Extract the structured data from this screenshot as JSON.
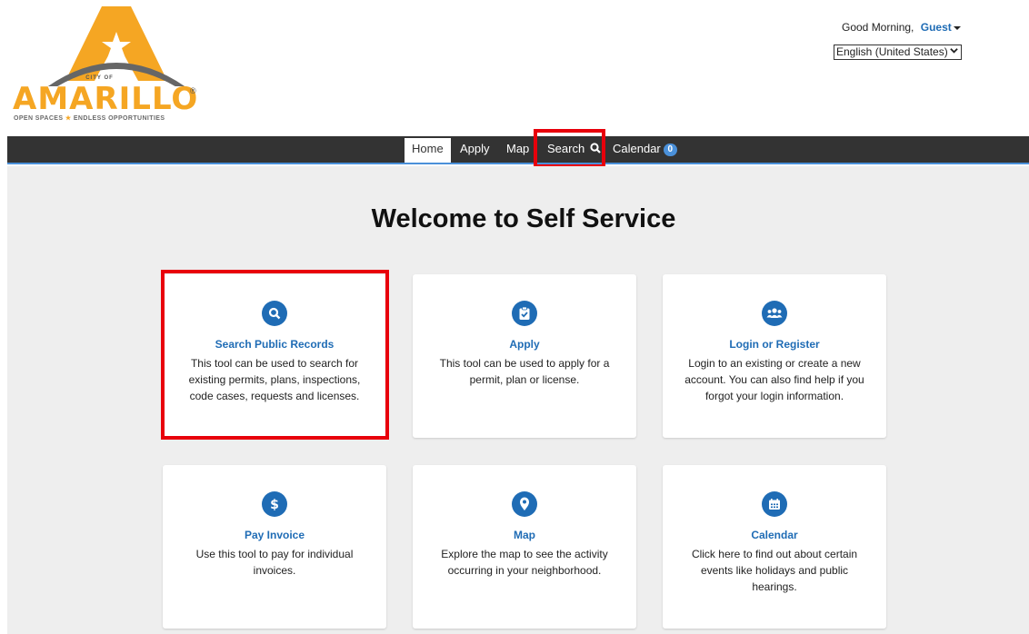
{
  "logo": {
    "city_of": "CITY OF",
    "word": "AMARILLO",
    "registered": "®",
    "tagline_left": "OPEN SPACES",
    "tagline_sep": "★",
    "tagline_right": "ENDLESS OPPORTUNITIES"
  },
  "header": {
    "greeting": "Good Morning,",
    "user": "Guest",
    "language": "English (United States)"
  },
  "nav": {
    "home": "Home",
    "apply": "Apply",
    "map": "Map",
    "search": "Search",
    "calendar": "Calendar",
    "calendar_count": "0"
  },
  "main": {
    "heading": "Welcome to Self Service",
    "cards": [
      {
        "icon": "search-icon",
        "title": "Search Public Records",
        "desc": "This tool can be used to search for existing permits, plans, inspections, code cases, requests and licenses."
      },
      {
        "icon": "clipboard-check-icon",
        "title": "Apply",
        "desc": "This tool can be used to apply for a permit, plan or license."
      },
      {
        "icon": "users-icon",
        "title": "Login or Register",
        "desc": "Login to an existing or create a new account. You can also find help if you forgot your login information."
      },
      {
        "icon": "dollar-icon",
        "title": "Pay Invoice",
        "desc": "Use this tool to pay for individual invoices."
      },
      {
        "icon": "map-pin-icon",
        "title": "Map",
        "desc": "Explore the map to see the activity occurring in your neighborhood."
      },
      {
        "icon": "calendar-icon",
        "title": "Calendar",
        "desc": "Click here to find out about certain events like holidays and public hearings."
      }
    ]
  },
  "colors": {
    "accent": "#1f6cb5",
    "nav_bg": "#333333",
    "highlight": "#e8000b",
    "logo_orange": "#f5a623"
  }
}
